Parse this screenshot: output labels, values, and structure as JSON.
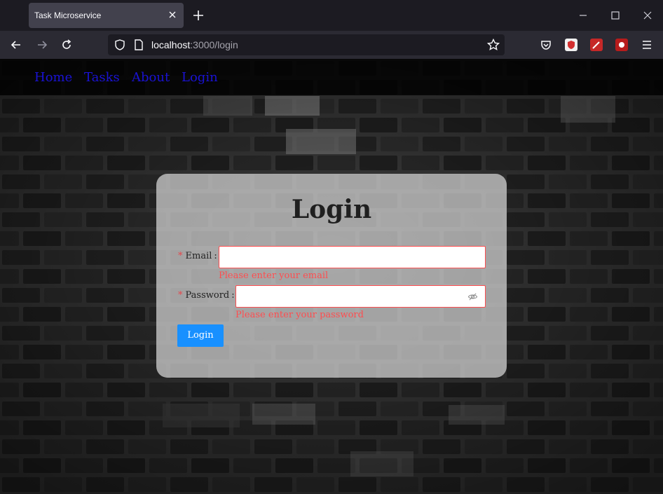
{
  "browser": {
    "tab_title": "Task Microservice",
    "url_host": "localhost",
    "url_path": ":3000/login"
  },
  "site_nav": {
    "items": [
      {
        "label": "Home"
      },
      {
        "label": "Tasks"
      },
      {
        "label": "About"
      },
      {
        "label": "Login"
      }
    ],
    "link_color": "#1a12d4"
  },
  "login": {
    "title": "Login",
    "email_label": "Email",
    "email_value": "",
    "email_error": "Please enter your email",
    "password_label": "Password",
    "password_value": "",
    "password_error": "Please enter your password",
    "submit_label": "Login",
    "required_mark": "*",
    "colors": {
      "primary": "#1890ff",
      "error": "#ff4d4f"
    }
  }
}
